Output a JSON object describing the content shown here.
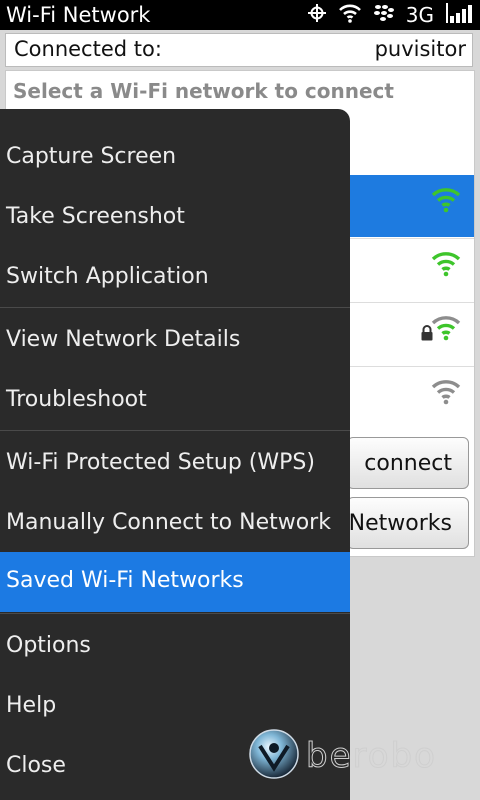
{
  "status_bar": {
    "title": "Wi-Fi Network",
    "network_type": "3G"
  },
  "connected": {
    "label": "Connected to:",
    "value": "puvisitor"
  },
  "network_list": {
    "header": "Select a Wi-Fi network to connect"
  },
  "buttons": {
    "connect": "connect",
    "networks": "Networks"
  },
  "menu": {
    "items": [
      "Capture Screen",
      "Take Screenshot",
      "Switch Application",
      "View Network Details",
      "Troubleshoot",
      "Wi-Fi Protected Setup (WPS)",
      "Manually Connect to Network",
      "Saved Wi-Fi Networks",
      "Options",
      "Help",
      "Close"
    ],
    "selected": "Saved Wi-Fi Networks"
  },
  "watermark": {
    "text": "berobo"
  },
  "colors": {
    "selection": "#1c7ae3",
    "signal_active": "#3ec52b",
    "signal_inactive": "#8d8d8d"
  }
}
